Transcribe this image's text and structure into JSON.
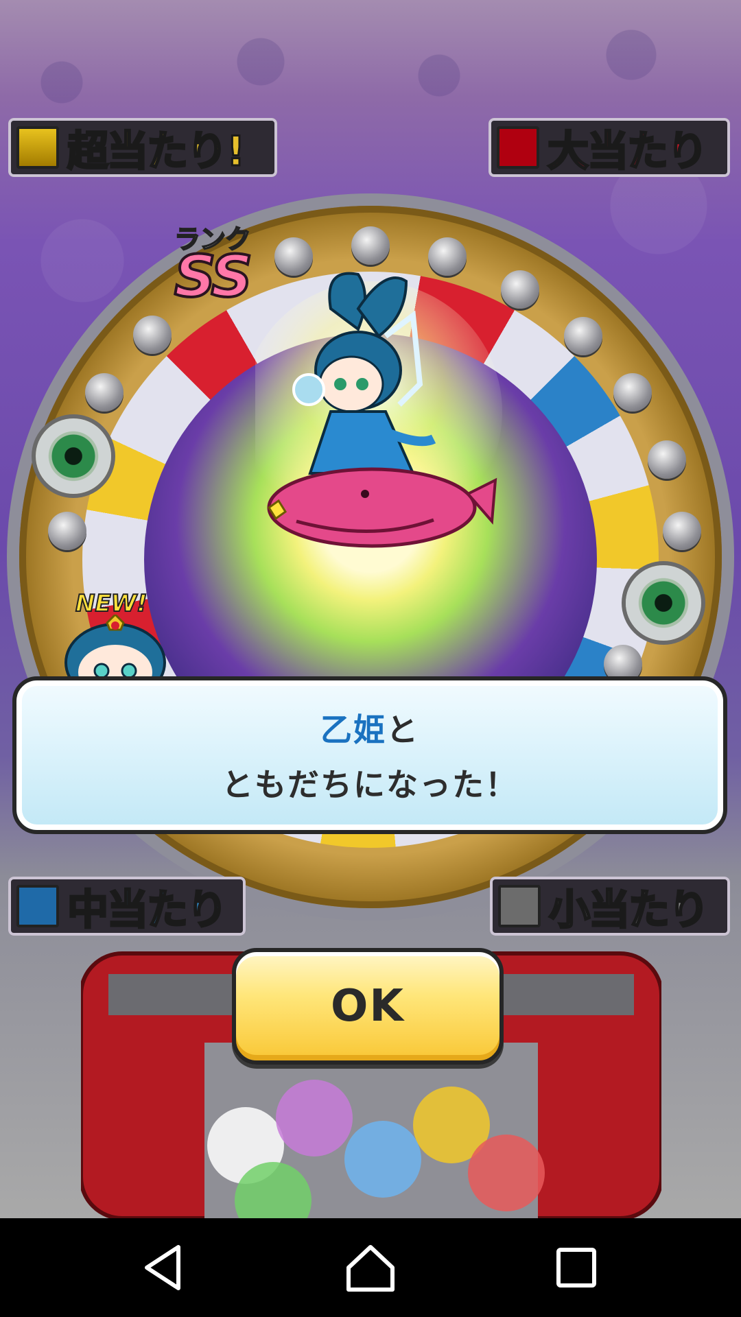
{
  "prizes": {
    "super": "超当たり!",
    "big": "大当たり",
    "mid": "中当たり",
    "small": "小当たり",
    "colors": {
      "super": "#e6bf2c",
      "big": "#c0101e",
      "mid": "#1f6aa8",
      "small": "#6c6c6c"
    }
  },
  "rank": {
    "label": "ランク",
    "value": "SS"
  },
  "badge": {
    "new": "NEW!"
  },
  "dialog": {
    "character_name": "乙姫",
    "line1_suffix": "と",
    "line2": "ともだちになった！"
  },
  "buttons": {
    "ok": "OK"
  },
  "icons": {
    "back": "back-triangle-icon",
    "home": "home-icon",
    "recents": "recents-square-icon"
  }
}
